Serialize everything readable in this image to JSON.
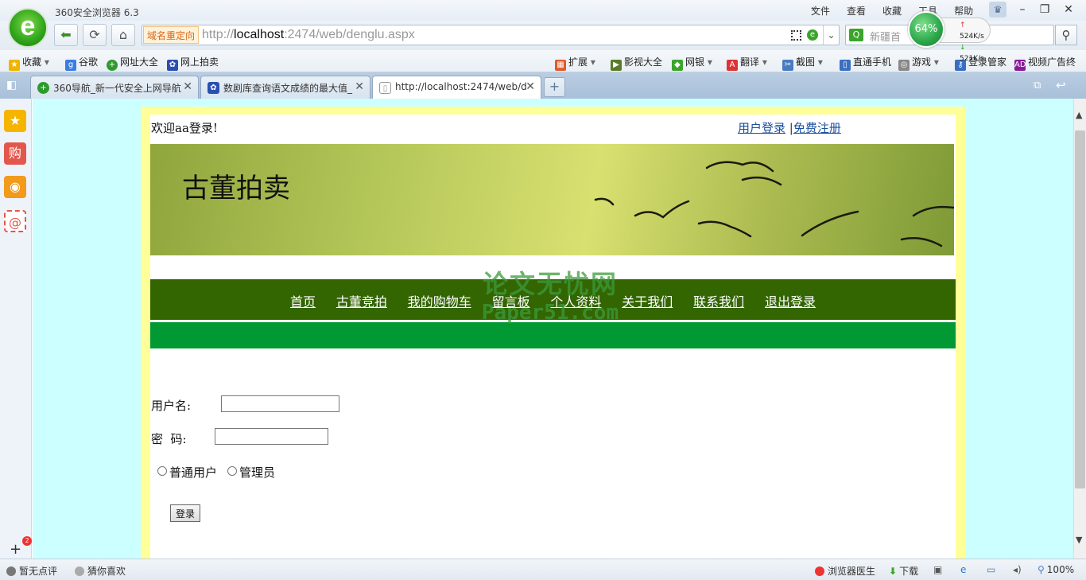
{
  "browser": {
    "app_title": "360安全浏览器 6.3",
    "logo_glyph": "e",
    "window_menu": [
      "文件",
      "查看",
      "收藏",
      "工具",
      "帮助"
    ],
    "window_controls": [
      "–",
      "❐",
      "✕"
    ],
    "address": {
      "redirect_tag": "域名重定向",
      "url_scheme": "http://",
      "url_host": "localhost",
      "url_rest": ":2474/web/denglu.aspx"
    },
    "search": {
      "placeholder": "新疆首"
    },
    "speed": {
      "percent": "64%",
      "up": "524K/s",
      "down": "521K/s"
    },
    "favorites": {
      "items": [
        "收藏",
        "谷歌",
        "网址大全",
        "网上拍卖"
      ],
      "tools": [
        "扩展",
        "影视大全",
        "网银",
        "翻译",
        "截图",
        "直通手机",
        "游戏",
        "登录管家",
        "视频广告终"
      ]
    },
    "tabs": [
      {
        "label": "360导航_新一代安全上网导航",
        "active": false
      },
      {
        "label": "数剧库查询语文成绩的最大值_",
        "active": false
      },
      {
        "label": "http://localhost:2474/web/d",
        "active": true
      }
    ],
    "status": {
      "left": [
        "暂无点评",
        "猜你喜欢"
      ],
      "right": [
        "浏览器医生",
        "下载"
      ],
      "zoom": "100%"
    },
    "sidebar_badge": "2"
  },
  "page": {
    "welcome": "欢迎aa登录!",
    "top_links": {
      "login": "用户登录",
      "separator": "|",
      "register": "免费注册"
    },
    "banner_title": "古董拍卖",
    "menu": [
      "首页",
      "古董竞拍",
      "我的购物车",
      "留言板",
      "个人资料",
      "关于我们",
      "联系我们",
      "退出登录"
    ],
    "watermark": {
      "line1": "论文无忧网",
      "line2": "Paper51.com"
    },
    "form": {
      "username_label": "用户名:",
      "password_label": "密  码:",
      "username_value": "",
      "password_value": "",
      "role_options": [
        "普通用户",
        "管理员"
      ],
      "login_button": "登录"
    }
  },
  "colors": {
    "page_bg": "#ccffff",
    "frame": "#ffff99",
    "menu_bar": "#336600",
    "green_bar": "#009933"
  }
}
